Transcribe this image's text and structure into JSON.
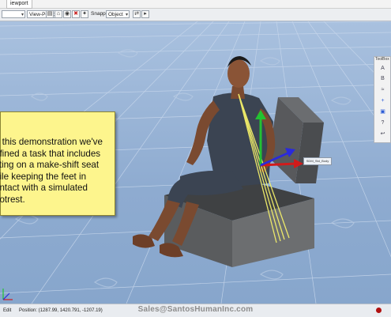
{
  "window": {
    "tab_title": "iewport"
  },
  "toolbar": {
    "view_select": "",
    "perspective_select": "View-Persp",
    "snapping_label": "Snapping:",
    "snapping_select": "Object",
    "icons": [
      "open-icon",
      "home-icon",
      "camera-icon",
      "light-icon",
      "settings-icon",
      "link-icon",
      "arrow-icon"
    ]
  },
  "viewport": {
    "callout_text": "n this demonstration we've\nefined a task that includes\nitting on a make-shift seat\nhile keeping the feet in\nontact with a simulated\nootrest.",
    "target_tag": "SDM_Std_Body",
    "side_panel": {
      "title": "ToolBox",
      "buttons": [
        "A",
        "B",
        "≈",
        "+",
        "▣",
        "?",
        "↩"
      ]
    },
    "colors": {
      "grid_background": "#9fb7d6",
      "callout_background": "#fdf58d",
      "box_color": "#5a5c5e",
      "axis_red": "#d21b1b",
      "axis_green": "#22c232",
      "axis_blue": "#2a2adb",
      "sightline_yellow": "#f4f06a"
    }
  },
  "statusbar": {
    "mode": "Edit",
    "position": "Position: (1287.99, 1420.791, -1207.19)",
    "email": "Sales@SantosHumanInc.com"
  }
}
